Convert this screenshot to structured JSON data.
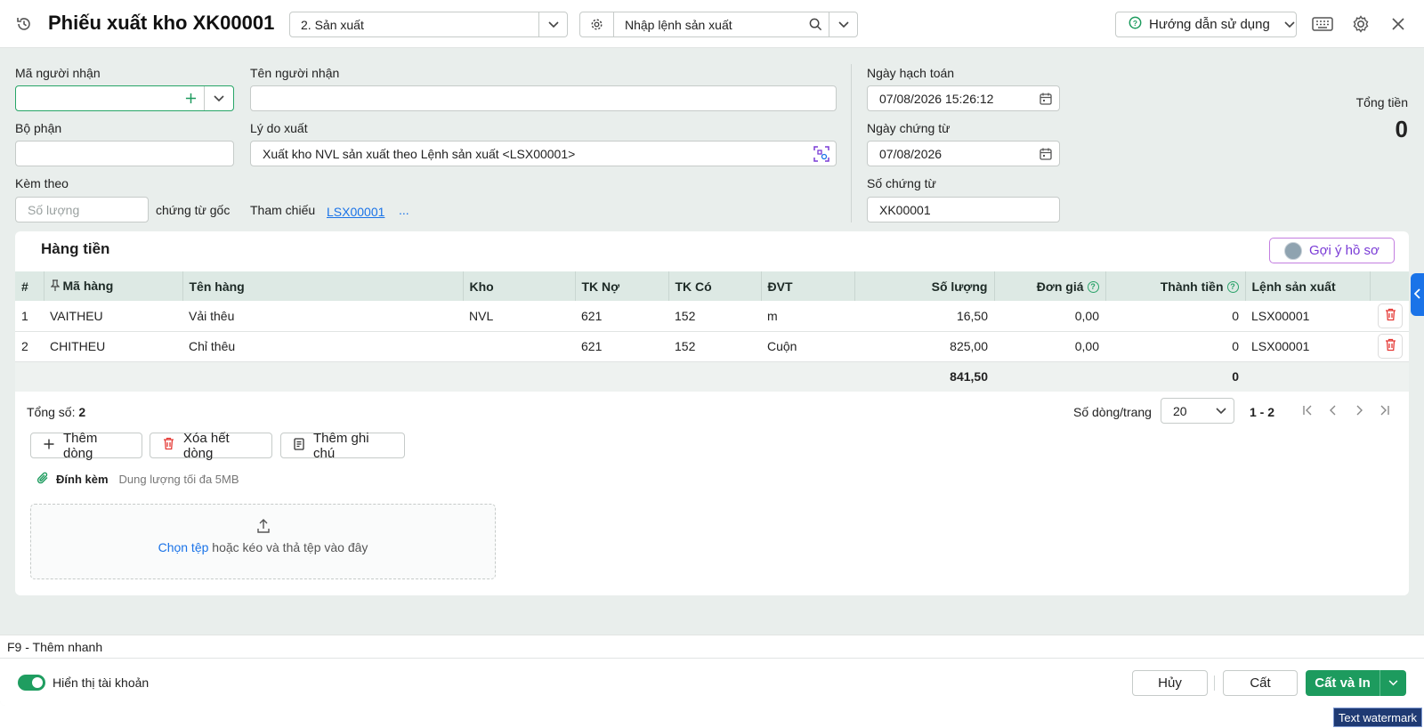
{
  "header": {
    "title": "Phiếu xuất kho XK00001",
    "purpose_select": "2. Sản xuất",
    "production_order_placeholder": "Nhập lệnh sản xuất",
    "help_label": "Hướng dẫn sử dụng"
  },
  "form": {
    "receiver_code_label": "Mã người nhận",
    "receiver_code_value": "",
    "receiver_name_label": "Tên người nhận",
    "receiver_name_value": "",
    "department_label": "Bộ phận",
    "department_value": "",
    "reason_label": "Lý do xuất",
    "reason_value": "Xuất kho NVL sản xuất theo Lệnh sản xuất <LSX00001>",
    "attached_label": "Kèm theo",
    "attached_placeholder": "Số lượng",
    "original_docs_label": "chứng từ gốc",
    "reference_label": "Tham chiếu",
    "reference_link": "LSX00001",
    "reference_more": "...",
    "posting_date_label": "Ngày hạch toán",
    "posting_date_value": "07/08/2026 15:26:12",
    "voucher_date_label": "Ngày chứng từ",
    "voucher_date_value": "07/08/2026",
    "voucher_no_label": "Số chứng từ",
    "voucher_no_value": "XK00001",
    "total_label": "Tổng tiền",
    "total_value": "0"
  },
  "items": {
    "section_title": "Hàng tiền",
    "suggest_label": "Gợi ý hồ sơ",
    "columns": [
      "#",
      "Mã hàng",
      "Tên hàng",
      "Kho",
      "TK Nợ",
      "TK Có",
      "ĐVT",
      "Số lượng",
      "Đơn giá",
      "Thành tiền",
      "Lệnh sản xuất"
    ],
    "rows": [
      {
        "no": "1",
        "code": "VAITHEU",
        "name": "Vải thêu",
        "warehouse": "NVL",
        "debit": "621",
        "credit": "152",
        "unit": "m",
        "qty": "16,50",
        "price": "0,00",
        "amount": "0",
        "order": "LSX00001"
      },
      {
        "no": "2",
        "code": "CHITHEU",
        "name": "Chỉ thêu",
        "warehouse": "",
        "debit": "621",
        "credit": "152",
        "unit": "Cuộn",
        "qty": "825,00",
        "price": "0,00",
        "amount": "0",
        "order": "LSX00001"
      }
    ],
    "total_qty": "841,50",
    "total_amount": "0",
    "count_label": "Tổng số:",
    "count_value": "2",
    "rows_per_page_label": "Số dòng/trang",
    "rows_per_page_value": "20",
    "range": "1 - 2",
    "add_row": "Thêm dòng",
    "delete_all": "Xóa hết dòng",
    "add_note": "Thêm ghi chú"
  },
  "attachment": {
    "label": "Đính kèm",
    "limit": "Dung lượng tối đa 5MB",
    "choose": "Chọn tệp",
    "drop_text": " hoặc kéo và thả tệp vào đây"
  },
  "shortcut": "F9 - Thêm nhanh",
  "footer": {
    "show_accounts": "Hiển thị tài khoản",
    "cancel": "Hủy",
    "save": "Cất",
    "save_print": "Cất và In"
  },
  "watermark": "Text watermark",
  "colors": {
    "primary": "#1d9b5e",
    "link": "#1a73e8",
    "danger": "#e53935",
    "accent_purple": "#7a3bd6"
  }
}
